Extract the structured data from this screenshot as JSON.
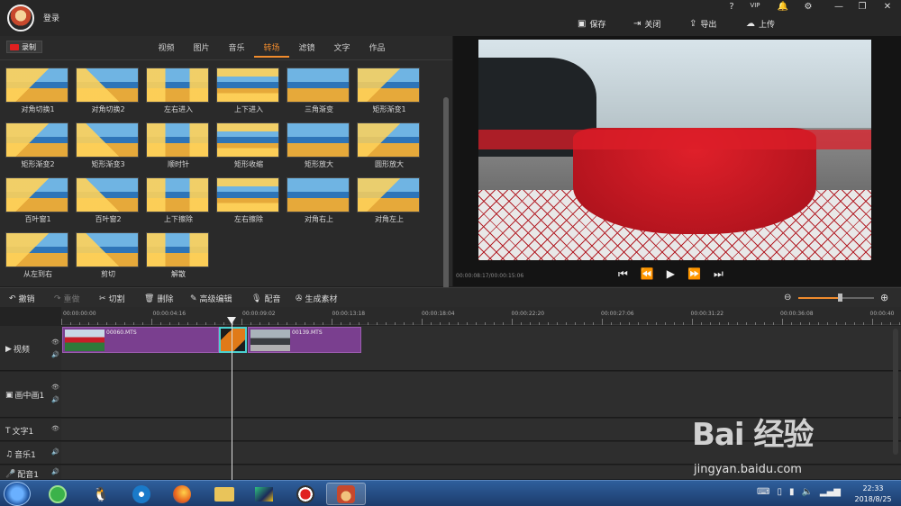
{
  "window": {
    "login_label": "登录",
    "controls": [
      "?",
      "VIP",
      "🔔",
      "⚙",
      "—",
      "❐",
      "✕"
    ]
  },
  "actions": [
    {
      "icon": "save-icon",
      "label": "保存"
    },
    {
      "icon": "close-doc-icon",
      "label": "关闭"
    },
    {
      "icon": "export-icon",
      "label": "导出"
    },
    {
      "icon": "upload-icon",
      "label": "上传"
    }
  ],
  "record_label": "录制",
  "tabs": [
    {
      "label": "视频",
      "active": false
    },
    {
      "label": "图片",
      "active": false
    },
    {
      "label": "音乐",
      "active": false
    },
    {
      "label": "转场",
      "active": true
    },
    {
      "label": "滤镜",
      "active": false
    },
    {
      "label": "文字",
      "active": false
    },
    {
      "label": "作品",
      "active": false
    }
  ],
  "transitions": [
    "对角切换1",
    "对角切换2",
    "左右进入",
    "上下进入",
    "三角渐变",
    "矩形渐变1",
    "矩形渐变2",
    "矩形渐变3",
    "顺时针",
    "矩形收缩",
    "矩形放大",
    "圆形放大",
    "百叶窗1",
    "百叶窗2",
    "上下擦除",
    "左右擦除",
    "对角右上",
    "对角左上",
    "从左到右",
    "剪切",
    "解散"
  ],
  "preview": {
    "timecode": "00:00:08:17/00:00:15:06",
    "controls": [
      "⏮",
      "⏪",
      "▶",
      "⏩",
      "⏭"
    ]
  },
  "toolbar": [
    {
      "icon": "undo-icon",
      "label": "撤销",
      "enabled": true
    },
    {
      "icon": "redo-icon",
      "label": "重做",
      "enabled": false
    },
    {
      "icon": "scissors-icon",
      "label": "切割",
      "enabled": true
    },
    {
      "icon": "trash-icon",
      "label": "删除",
      "enabled": true
    },
    {
      "icon": "pen-icon",
      "label": "高级编辑",
      "enabled": true
    },
    {
      "icon": "mic-icon",
      "label": "配音",
      "enabled": true
    },
    {
      "icon": "film-icon",
      "label": "生成素材",
      "enabled": true
    }
  ],
  "zoom_level": 0.55,
  "ruler": [
    "00:00:00:00",
    "00:00:04:16",
    "00:00:09:02",
    "00:00:13:18",
    "00:00:18:04",
    "00:00:22:20",
    "00:00:27:06",
    "00:00:31:22",
    "00:00:36:08",
    "00:00:40"
  ],
  "tracks": [
    {
      "label": "视频",
      "icon": "▶"
    },
    {
      "label": "画中画1",
      "icon": "▣"
    },
    {
      "label": "文字1",
      "icon": "T"
    },
    {
      "label": "音乐1",
      "icon": "♫"
    },
    {
      "label": "配音1",
      "icon": "🎤"
    }
  ],
  "clips": [
    {
      "name": "00060.MTS"
    },
    {
      "name": "00139.MTS"
    }
  ],
  "watermark": {
    "big": "Bai 经验",
    "small": "jingyan.baidu.com"
  },
  "clock": {
    "time": "22:33",
    "date": "2018/8/25"
  }
}
